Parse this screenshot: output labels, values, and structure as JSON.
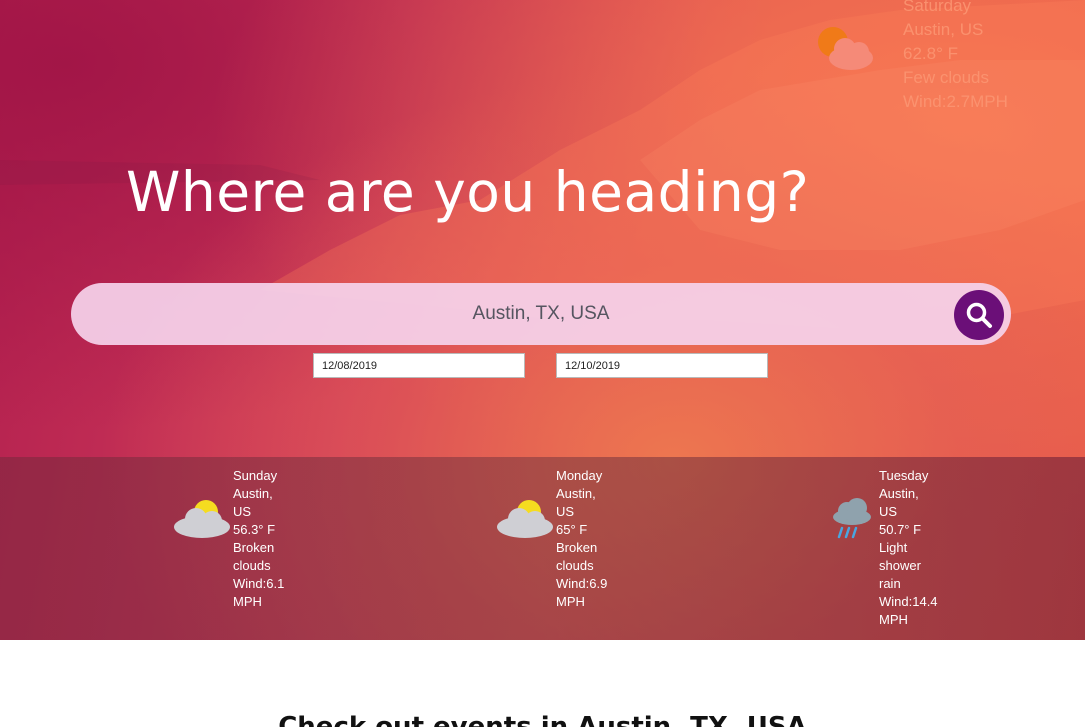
{
  "hero": {
    "heading": "Where are you heading?",
    "search": {
      "value": "Austin, TX, USA"
    },
    "dates": {
      "start": "12/08/2019",
      "end": "12/10/2019"
    }
  },
  "current_weather": {
    "day": "Saturday",
    "location": "Austin, US",
    "temp": "62.8° F",
    "condition": "Few clouds",
    "wind": "Wind:2.7MPH",
    "icon": "sun-behind-cloud-icon"
  },
  "forecast": [
    {
      "day": "Sunday",
      "location_line1": "Austin,",
      "location_line2": "US",
      "temp": "56.3° F",
      "condition_line1": "Broken",
      "condition_line2": "clouds",
      "wind_line1": "Wind:6.1",
      "wind_line2": "MPH",
      "icon": "partly-cloudy-icon"
    },
    {
      "day": "Monday",
      "location_line1": "Austin,",
      "location_line2": "US",
      "temp": "65° F",
      "condition_line1": "Broken",
      "condition_line2": "clouds",
      "wind_line1": "Wind:6.9",
      "wind_line2": "MPH",
      "icon": "partly-cloudy-icon"
    },
    {
      "day": "Tuesday",
      "location_line1": "Austin,",
      "location_line2": "US",
      "temp": "50.7° F",
      "condition_line1": "Light",
      "condition_line2": "shower",
      "condition_line3": "rain",
      "wind_line1": "Wind:14.4",
      "wind_line2": "MPH",
      "icon": "rain-cloud-icon"
    }
  ],
  "section": {
    "title": "Check out events in Austin, TX, USA"
  },
  "colors": {
    "accent": "#6b0f78",
    "hero_start": "#b3204f",
    "hero_end": "#e85a46"
  }
}
